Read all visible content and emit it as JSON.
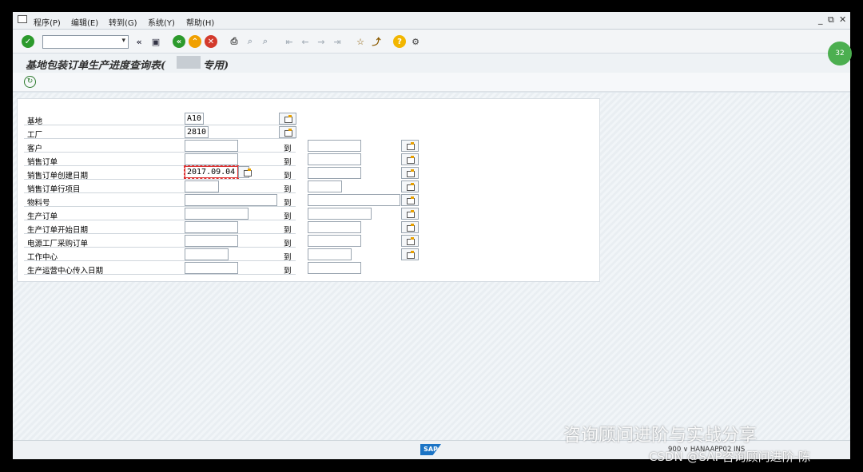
{
  "menu": [
    "程序(P)",
    "编辑(E)",
    "转到(G)",
    "系统(Y)",
    "帮助(H)"
  ],
  "window_controls": [
    "_",
    "⧉",
    "✕"
  ],
  "title": "基地包装订单生产进度查询表(",
  "title_suffix": "专用)",
  "rows": [
    {
      "label": "基地",
      "low": "A10",
      "to": "",
      "high": "",
      "multi": false
    },
    {
      "label": "工厂",
      "low": "2810",
      "to": "",
      "high": "",
      "multi": false
    },
    {
      "label": "客户",
      "low": "",
      "to": "到",
      "high": "",
      "multi": true
    },
    {
      "label": "销售订单",
      "low": "",
      "to": "到",
      "high": "",
      "multi": true
    },
    {
      "label": "销售订单创建日期",
      "low": "2017.09.04",
      "to": "到",
      "high": "",
      "multi": true
    },
    {
      "label": "销售订单行项目",
      "low": "",
      "to": "到",
      "high": "",
      "multi": true
    },
    {
      "label": "物料号",
      "low": "",
      "to": "到",
      "high": "",
      "multi": true
    },
    {
      "label": "生产订单",
      "low": "",
      "to": "到",
      "high": "",
      "multi": true
    },
    {
      "label": "生产订单开始日期",
      "low": "",
      "to": "到",
      "high": "",
      "multi": true
    },
    {
      "label": "电源工厂采购订单",
      "low": "",
      "to": "到",
      "high": "",
      "multi": true
    },
    {
      "label": "工作中心",
      "low": "",
      "to": "到",
      "high": "",
      "multi": true
    },
    {
      "label": "生产运营中心传入日期",
      "low": "",
      "to": "到",
      "high": "",
      "multi": false
    }
  ],
  "status": {
    "logo": "SAP",
    "system": "900 ∨  HANAAPP02  INS"
  },
  "badge": "32",
  "watermark": {
    "line1": "咨询顾问进阶与实战分享",
    "line2": "CSDN @SAP咨询顾问进阶-陈"
  },
  "colors": {
    "accent_green": "#2c9a2c",
    "exit_orange": "#f0a000",
    "cancel_red": "#d33a2c",
    "help_yellow": "#f2b600"
  }
}
